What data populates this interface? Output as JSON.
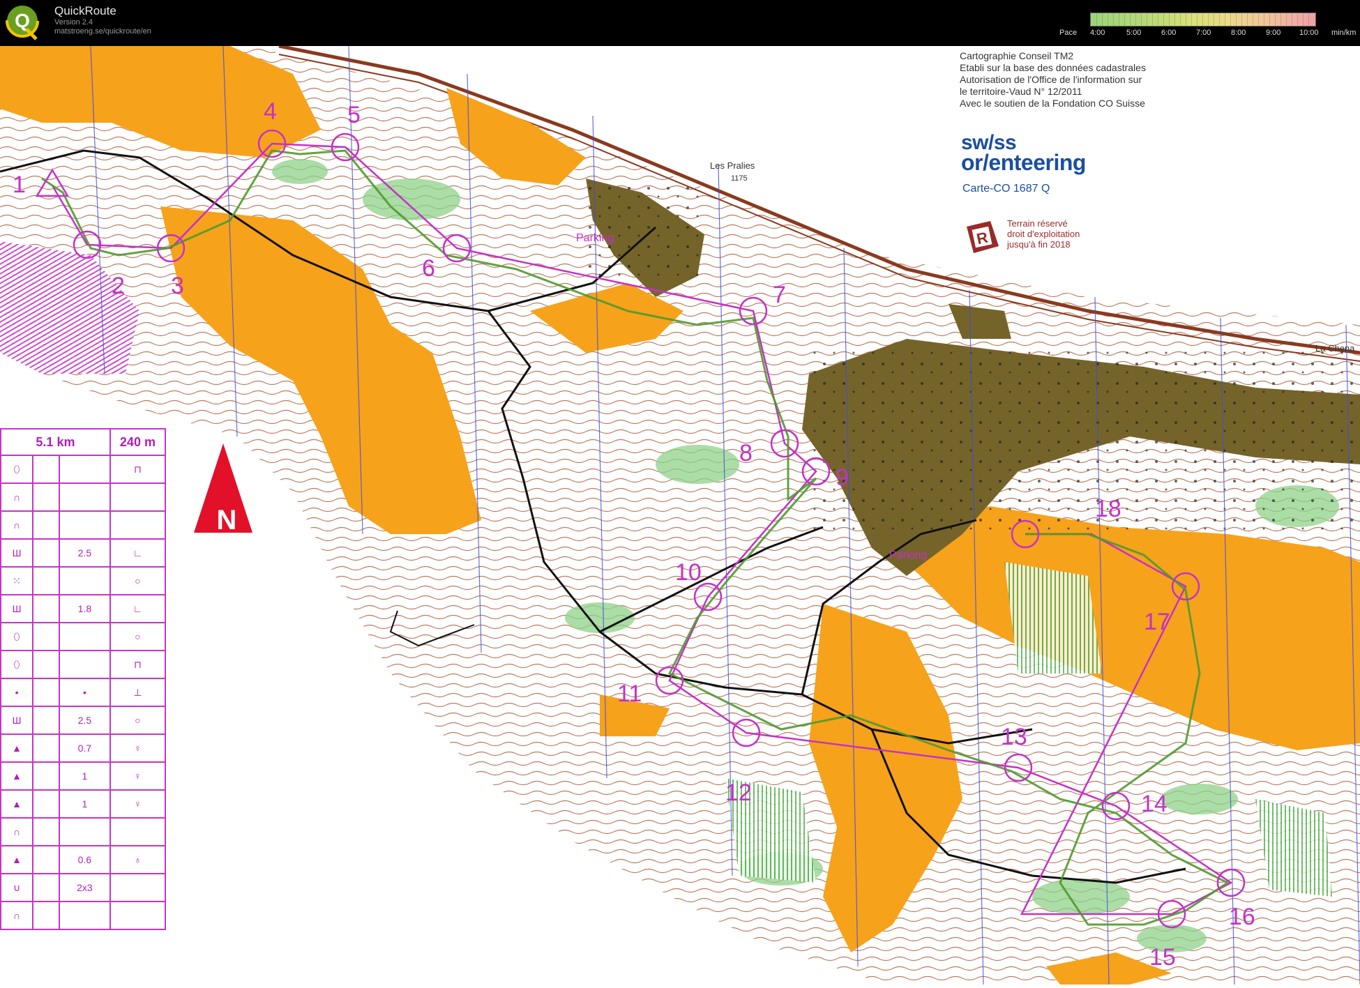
{
  "app": {
    "name": "QuickRoute",
    "version": "Version 2.4",
    "url": "matstroeng.se/quickroute/en",
    "logo_letter": "Q"
  },
  "pace_legend": {
    "label": "Pace",
    "ticks": [
      "4:00",
      "5:00",
      "6:00",
      "7:00",
      "8:00",
      "9:00",
      "10:00"
    ],
    "unit": "min/km",
    "colors": [
      "#9bd47a",
      "#d9e07a",
      "#f0c69a",
      "#f0a0a8"
    ]
  },
  "map": {
    "credits": [
      "Cartographie Conseil TM2",
      "Etabli sur la base des données cadastrales",
      "Autorisation de l'Office de l'information sur",
      "le territoire-Vaud N° 12/2011",
      "Avec le soutien de la Fondation CO Suisse"
    ],
    "logo_line1": "sw/ss",
    "logo_line2": "or/enteering",
    "map_id": "Carte-CO 1687 Q",
    "reserve_icon_letter": "R",
    "reserve_text": [
      "Terrain réservé",
      "droit d'exploitation",
      "jusqu'à fin 2018"
    ],
    "place_names": [
      "Les Pralies",
      "1175",
      "La Chena"
    ],
    "parking_labels": [
      "Parking",
      "Parking"
    ],
    "north_letter": "N",
    "controls": [
      "1",
      "2",
      "3",
      "4",
      "5",
      "6",
      "7",
      "8",
      "9",
      "10",
      "11",
      "12",
      "13",
      "14",
      "15",
      "16",
      "17",
      "18"
    ],
    "colors": {
      "open_land": "#f7a21b",
      "forest_green": "#8fd18a",
      "settlement": "#75642a",
      "course_purple": "#c531c7",
      "contour_brown": "#8a3a1e",
      "route": "#4f9a2c"
    }
  },
  "description_table": {
    "length": "5.1 km",
    "climb": "240 m",
    "rows": [
      {
        "d": "⬯",
        "dist": "",
        "s": "⊓"
      },
      {
        "d": "∩",
        "dist": "",
        "s": ""
      },
      {
        "d": "∩",
        "dist": "",
        "s": ""
      },
      {
        "d": "Ш",
        "dist": "2.5",
        "s": "∟"
      },
      {
        "d": "⁙",
        "dist": "",
        "s": "○"
      },
      {
        "d": "Ш",
        "dist": "1.8",
        "s": "∟"
      },
      {
        "d": "⬯",
        "dist": "",
        "s": "○"
      },
      {
        "d": "⬯",
        "dist": "",
        "s": "⊓"
      },
      {
        "d": "•",
        "dist": "•",
        "s": "⊥"
      },
      {
        "d": "Ш",
        "dist": "2.5",
        "s": "○"
      },
      {
        "d": "▲",
        "dist": "0.7",
        "s": "♀"
      },
      {
        "d": "▲",
        "dist": "1",
        "s": "♀"
      },
      {
        "d": "▲",
        "dist": "1",
        "s": "♀"
      },
      {
        "d": "∩",
        "dist": "",
        "s": ""
      },
      {
        "d": "▲",
        "dist": "0.6",
        "s": "♁"
      },
      {
        "d": "∪",
        "dist": "2x3",
        "s": ""
      },
      {
        "d": "∩",
        "dist": "",
        "s": ""
      }
    ]
  }
}
